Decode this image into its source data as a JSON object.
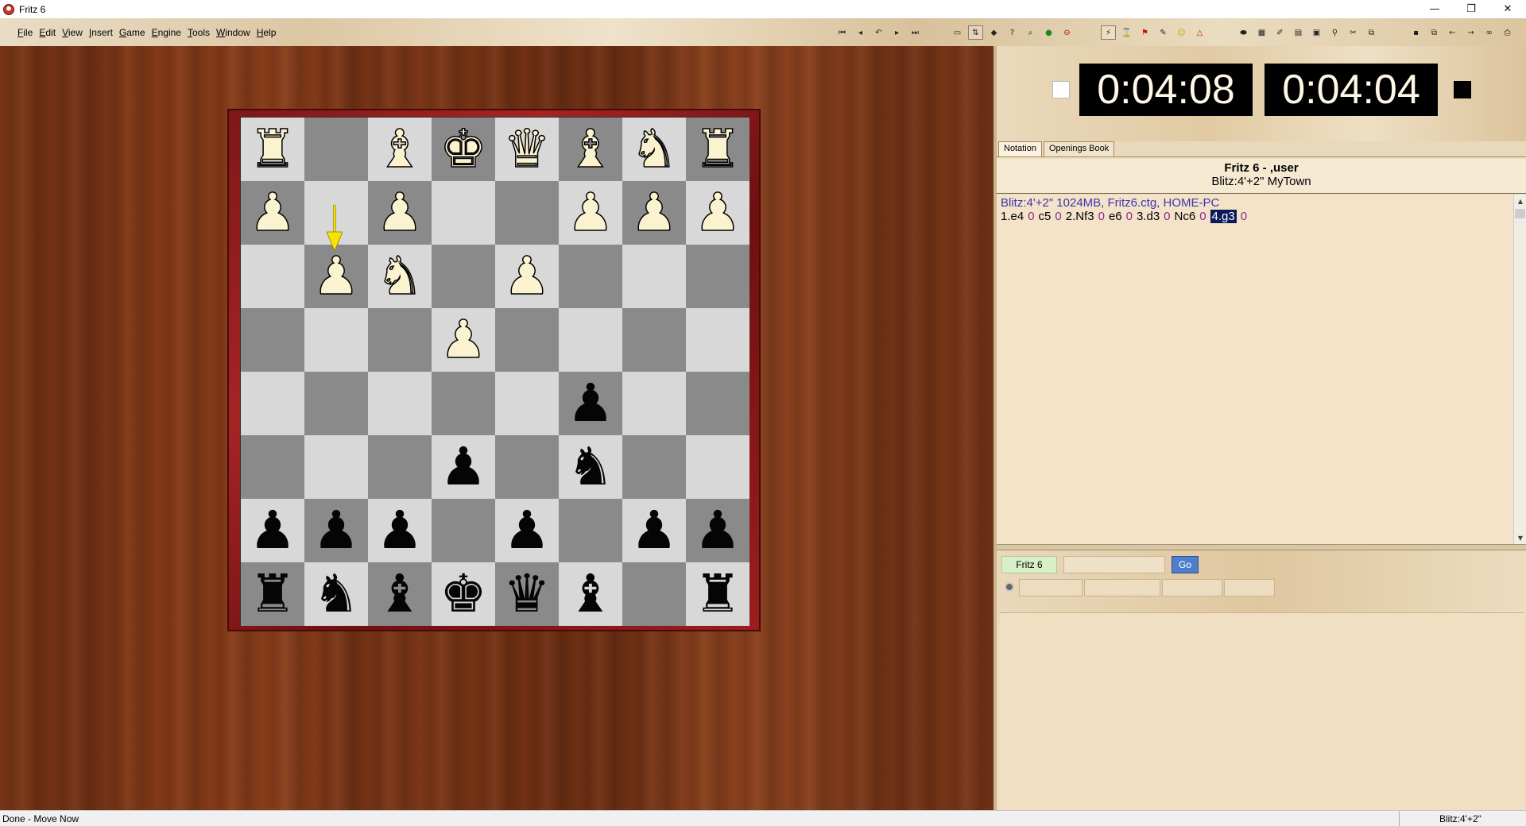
{
  "window": {
    "title": "Fritz 6",
    "controls": [
      "—",
      "❐",
      "✕"
    ]
  },
  "menu": [
    "File",
    "Edit",
    "View",
    "Insert",
    "Game",
    "Engine",
    "Tools",
    "Window",
    "Help"
  ],
  "toolbar": {
    "nav": [
      "first-move-icon",
      "prev-move-icon",
      "take-back-icon",
      "next-move-icon",
      "last-move-icon"
    ],
    "game": [
      "new-game-icon",
      "flip-board-icon",
      "move-icon",
      "hint-icon",
      "search-icon",
      "accept-icon",
      "stop-icon"
    ],
    "analysis": [
      "engine-icon",
      "blunder-icon",
      "flag-icon",
      "pen-icon",
      "smiley-icon",
      "triangle-icon"
    ],
    "windows": [
      "tool-1-icon",
      "tool-2-icon",
      "tool-3-icon",
      "tool-4-icon",
      "tool-5-icon",
      "tool-6-icon",
      "tool-7-icon",
      "tool-8-icon"
    ],
    "file": [
      "save-icon",
      "copy-icon",
      "back-icon",
      "forward-icon",
      "binoculars-icon",
      "print-icon"
    ]
  },
  "board": {
    "ranks": [
      [
        "R",
        "",
        "B",
        "K",
        "Q",
        "B",
        "N",
        "R"
      ],
      [
        "P",
        "",
        "P",
        "",
        "",
        "P",
        "P",
        "P"
      ],
      [
        "",
        "P",
        "N",
        "",
        "P",
        "",
        "",
        ""
      ],
      [
        "",
        "",
        "",
        "P",
        "",
        "",
        "",
        ""
      ],
      [
        "",
        "",
        "",
        "",
        "",
        "p",
        "",
        ""
      ],
      [
        "",
        "",
        "",
        "p",
        "",
        "n",
        "",
        ""
      ],
      [
        "p",
        "p",
        "p",
        "",
        "p",
        "",
        "p",
        "p"
      ],
      [
        "r",
        "n",
        "b",
        "k",
        "q",
        "b",
        "",
        "r"
      ]
    ],
    "arrow_color": "#f4e400",
    "light_color": "#d8d8d8",
    "dark_color": "#8a8a8a"
  },
  "clocks": {
    "white": "0:04:08",
    "black": "0:04:04"
  },
  "tabs": [
    "Notation",
    "Openings Book"
  ],
  "game": {
    "players": "Fritz 6 - ,user",
    "event": "Blitz:4'+2\" MyTown",
    "info": "Blitz:4'+2\"  1024MB, Fritz6.ctg, HOME-PC",
    "moves": [
      {
        "move": "1.e4",
        "clock": "0"
      },
      {
        "move": "c5",
        "clock": "0"
      },
      {
        "move": "2.Nf3",
        "clock": "0"
      },
      {
        "move": "e6",
        "clock": "0"
      },
      {
        "move": "3.d3",
        "clock": "0"
      },
      {
        "move": "Nc6",
        "clock": "0"
      },
      {
        "move": "4.g3",
        "clock": "0",
        "current": true
      }
    ]
  },
  "engine": {
    "name": "Fritz 6",
    "go_label": "Go"
  },
  "status": {
    "left": "Done - Move Now",
    "right": "Blitz:4'+2\""
  }
}
